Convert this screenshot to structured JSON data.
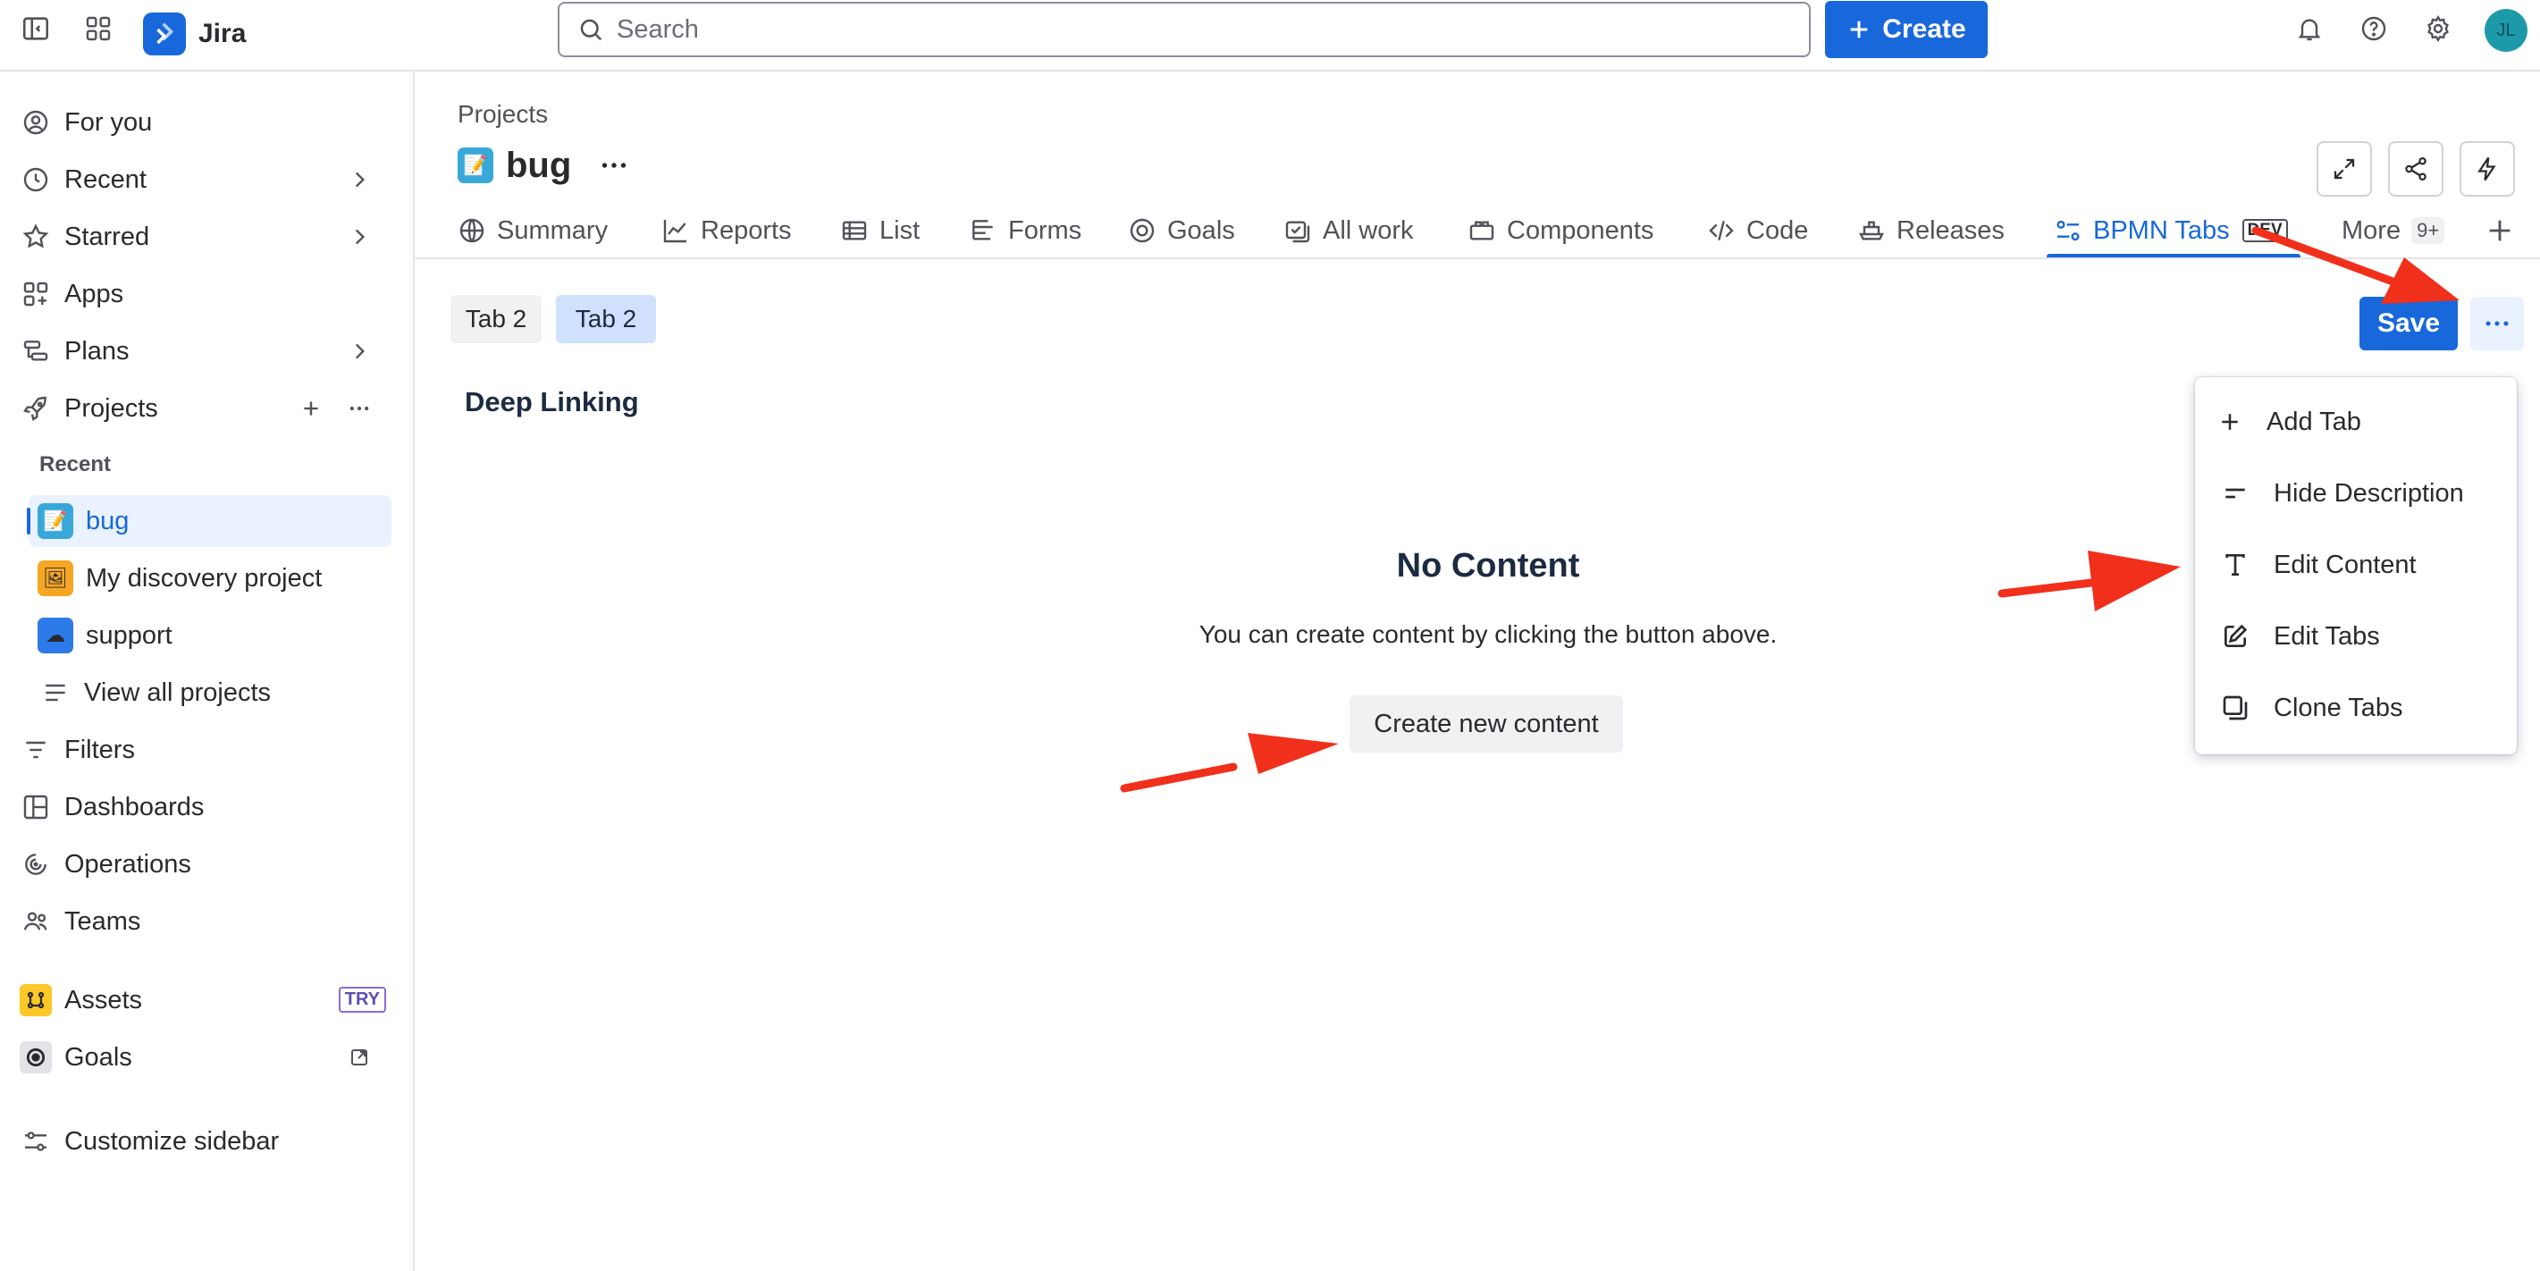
{
  "topbar": {
    "app_name": "Jira",
    "search": {
      "placeholder": "Search"
    },
    "create_label": "Create",
    "avatar_initials": "JL",
    "icons": [
      "sidebar-toggle-icon",
      "app-switcher-icon",
      "bell-icon",
      "help-icon",
      "gear-icon"
    ]
  },
  "sidebar": {
    "items": [
      {
        "label": "For you",
        "icon": "user-circle-icon"
      },
      {
        "label": "Recent",
        "icon": "clock-icon"
      },
      {
        "label": "Starred",
        "icon": "star-icon"
      },
      {
        "label": "Apps",
        "icon": "apps-icon"
      },
      {
        "label": "Plans",
        "icon": "plans-icon"
      },
      {
        "label": "Projects",
        "icon": "rocket-icon"
      }
    ],
    "recent_heading": "Recent",
    "projects": [
      {
        "label": "bug",
        "active": true
      },
      {
        "label": "My discovery project"
      },
      {
        "label": "support"
      }
    ],
    "view_all": "View all projects",
    "items2": [
      {
        "label": "Filters",
        "icon": "filter-icon"
      },
      {
        "label": "Dashboards",
        "icon": "dashboard-icon"
      },
      {
        "label": "Operations",
        "icon": "operations-icon"
      },
      {
        "label": "Teams",
        "icon": "teams-icon"
      }
    ],
    "assets": {
      "label": "Assets",
      "badge": "TRY"
    },
    "goals": {
      "label": "Goals"
    },
    "customize": "Customize sidebar"
  },
  "header": {
    "breadcrumb": "Projects",
    "title": "bug"
  },
  "tabs": [
    {
      "label": "Summary",
      "icon": "globe-icon"
    },
    {
      "label": "Reports",
      "icon": "chart-line-icon"
    },
    {
      "label": "List",
      "icon": "list-icon"
    },
    {
      "label": "Forms",
      "icon": "forms-icon"
    },
    {
      "label": "Goals",
      "icon": "goal-icon"
    },
    {
      "label": "All work",
      "icon": "all-work-icon"
    },
    {
      "label": "Components",
      "icon": "components-icon"
    },
    {
      "label": "Code",
      "icon": "code-icon"
    },
    {
      "label": "Releases",
      "icon": "ship-icon"
    },
    {
      "label": "BPMN Tabs",
      "icon": "bpmn-icon",
      "badge": "DEV",
      "active": true
    },
    {
      "label": "More",
      "badge": "9+"
    }
  ],
  "content": {
    "subtabs": [
      "Tab 2",
      "Tab 2"
    ],
    "section_title": "Deep Linking",
    "empty_title": "No Content",
    "empty_desc": "You can create content by clicking the button above.",
    "create_button": "Create new content",
    "save_button": "Save"
  },
  "menu": {
    "items": [
      {
        "label": "Add Tab",
        "icon": "plus-icon"
      },
      {
        "label": "Hide Description",
        "icon": "lines-icon"
      },
      {
        "label": "Edit Content",
        "icon": "text-icon"
      },
      {
        "label": "Edit Tabs",
        "icon": "edit-icon"
      },
      {
        "label": "Clone Tabs",
        "icon": "clone-icon"
      }
    ]
  },
  "colors": {
    "brand": "#1868db",
    "annotation_arrow": "#f0301b",
    "active_nav_bg": "#e9f2fe"
  }
}
